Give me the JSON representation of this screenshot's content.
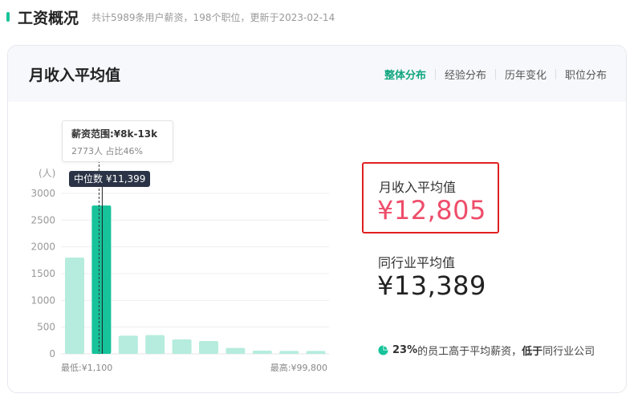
{
  "header": {
    "title": "工资概况",
    "subtitle": "共计5989条用户薪资，198个职位，更新于2023-02-14"
  },
  "card": {
    "title": "月收入平均值",
    "tabs": [
      {
        "label": "整体分布",
        "active": true
      },
      {
        "label": "经验分布",
        "active": false
      },
      {
        "label": "历年变化",
        "active": false
      },
      {
        "label": "职位分布",
        "active": false
      }
    ]
  },
  "tooltip": {
    "range": "薪资范围:¥8k-13k",
    "detail": "2773人 占比46%"
  },
  "median": {
    "label": "中位数 ¥11,399"
  },
  "stats": {
    "avg_label": "月收入平均值",
    "avg_value": "¥12,805",
    "industry_label": "同行业平均值",
    "industry_value": "¥13,389"
  },
  "footnote": {
    "pct": "23%",
    "text1": "的员工高于平均薪资，",
    "low": "低于",
    "text2": "同行业公司"
  },
  "colors": {
    "accent": "#16c39a",
    "bar": "#b5ecdd",
    "bar_active": "#16c39a",
    "highlight_value": "#ee4d6a",
    "badge_bg": "#2b3446"
  },
  "chart_data": {
    "type": "bar",
    "ylabel": "(人)",
    "ylim": [
      0,
      3000
    ],
    "yticks": [
      0,
      500,
      1000,
      1500,
      2000,
      2500,
      3000
    ],
    "values": [
      1800,
      2773,
      340,
      350,
      270,
      240,
      110,
      60,
      55,
      55
    ],
    "active_index": 1,
    "min_label": "最低:¥1,100",
    "max_label": "最高:¥99,800"
  }
}
